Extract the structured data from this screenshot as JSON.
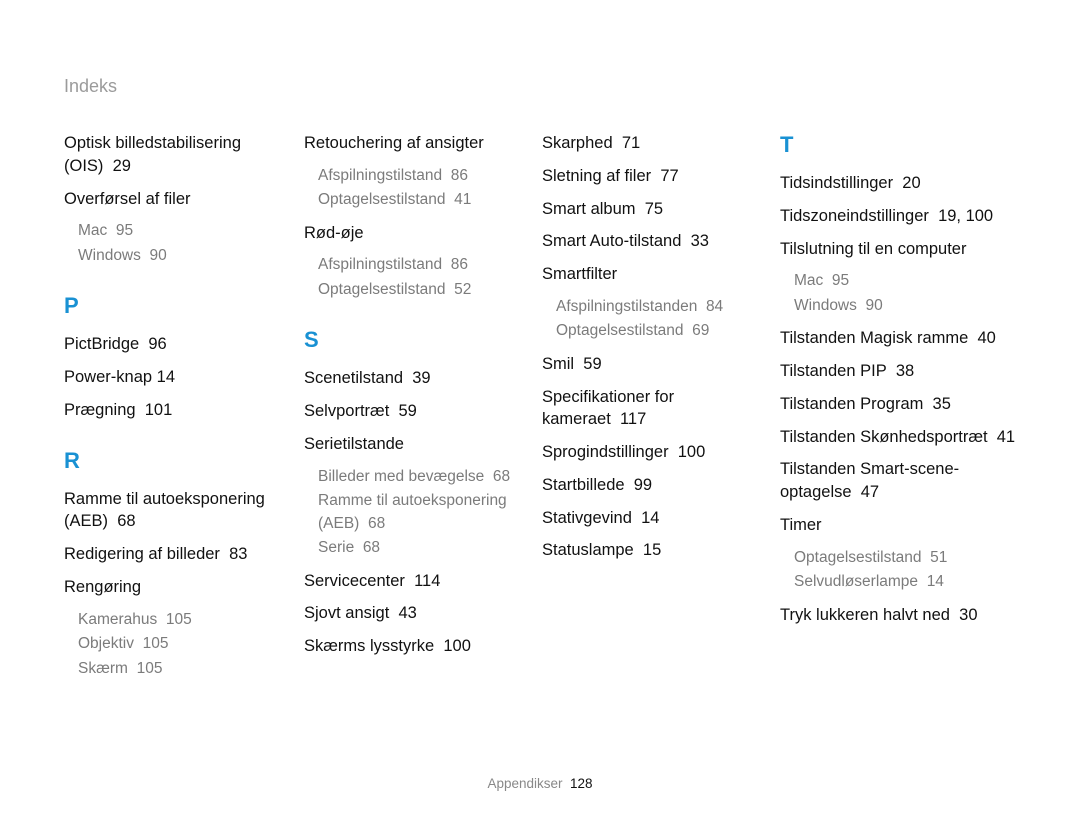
{
  "header": {
    "title": "Indeks"
  },
  "footer": {
    "label": "Appendikser",
    "page": "128"
  },
  "col1": {
    "e1_label": "Optisk billedstabilisering (OIS)",
    "e1_page": "29",
    "e2_label": "Overførsel af filer",
    "e2_sub1": "Mac",
    "e2_sub1_page": "95",
    "e2_sub2": "Windows",
    "e2_sub2_page": "90",
    "letterP": "P",
    "e3_label": "PictBridge",
    "e3_page": "96",
    "e4_label": "Power-knap",
    "e4_page": "14",
    "e5_label": "Prægning",
    "e5_page": "101",
    "letterR": "R",
    "e6_label": "Ramme til autoeksponering (AEB)",
    "e6_page": "68",
    "e7_label": "Redigering af billeder",
    "e7_page": "83",
    "e8_label": "Rengøring",
    "e8_sub1": "Kamerahus",
    "e8_sub1_page": "105",
    "e8_sub2": "Objektiv",
    "e8_sub2_page": "105",
    "e8_sub3": "Skærm",
    "e8_sub3_page": "105"
  },
  "col2": {
    "e1_label": "Retouchering af ansigter",
    "e1_sub1": "Afspilningstilstand",
    "e1_sub1_page": "86",
    "e1_sub2": "Optagelsestilstand",
    "e1_sub2_page": "41",
    "e2_label": "Rød-øje",
    "e2_sub1": "Afspilningstilstand",
    "e2_sub1_page": "86",
    "e2_sub2": "Optagelsestilstand",
    "e2_sub2_page": "52",
    "letterS": "S",
    "e3_label": "Scenetilstand",
    "e3_page": "39",
    "e4_label": "Selvportræt",
    "e4_page": "59",
    "e5_label": "Serietilstande",
    "e5_sub1": "Billeder med bevægelse",
    "e5_sub1_page": "68",
    "e5_sub2": "Ramme til autoeksponering (AEB)",
    "e5_sub2_page": "68",
    "e5_sub3": "Serie",
    "e5_sub3_page": "68",
    "e6_label": "Servicecenter",
    "e6_page": "114",
    "e7_label": "Sjovt ansigt",
    "e7_page": "43",
    "e8_label": "Skærms lysstyrke",
    "e8_page": "100"
  },
  "col3": {
    "e1_label": "Skarphed",
    "e1_page": "71",
    "e2_label": "Sletning af filer",
    "e2_page": "77",
    "e3_label": "Smart album",
    "e3_page": "75",
    "e4_label": "Smart Auto-tilstand",
    "e4_page": "33",
    "e5_label": "Smartfilter",
    "e5_sub1": "Afspilningstilstanden",
    "e5_sub1_page": "84",
    "e5_sub2": "Optagelsestilstand",
    "e5_sub2_page": "69",
    "e6_label": "Smil",
    "e6_page": "59",
    "e7_label": "Specifikationer for kameraet",
    "e7_page": "117",
    "e8_label": "Sprogindstillinger",
    "e8_page": "100",
    "e9_label": "Startbillede",
    "e9_page": "99",
    "e10_label": "Stativgevind",
    "e10_page": "14",
    "e11_label": "Statuslampe",
    "e11_page": "15"
  },
  "col4": {
    "letterT": "T",
    "e1_label": "Tidsindstillinger",
    "e1_page": "20",
    "e2_label": "Tidszoneindstillinger",
    "e2_page": "19, 100",
    "e3_label": "Tilslutning til en computer",
    "e3_sub1": "Mac",
    "e3_sub1_page": "95",
    "e3_sub2": "Windows",
    "e3_sub2_page": "90",
    "e4_label": "Tilstanden Magisk ramme",
    "e4_page": "40",
    "e5_label": "Tilstanden PIP",
    "e5_page": "38",
    "e6_label": "Tilstanden Program",
    "e6_page": "35",
    "e7_label": "Tilstanden Skønhedsportræt",
    "e7_page": "41",
    "e8_label": "Tilstanden Smart-scene-optagelse",
    "e8_page": "47",
    "e9_label": "Timer",
    "e9_sub1": "Optagelsestilstand",
    "e9_sub1_page": "51",
    "e9_sub2": "Selvudløserlampe",
    "e9_sub2_page": "14",
    "e10_label": "Tryk lukkeren halvt ned",
    "e10_page": "30"
  }
}
